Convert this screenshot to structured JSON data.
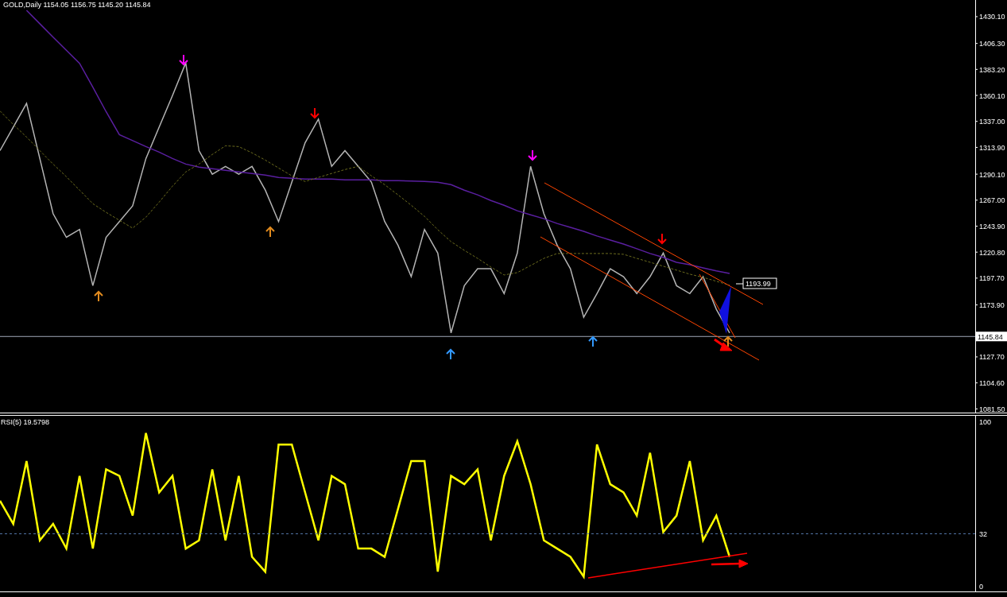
{
  "price_chart": {
    "title": "GOLD,Daily  1154.05 1156.75 1145.20 1145.84",
    "current_price": "1145.84",
    "price_label": "1193.99",
    "chart_data": {
      "type": "line",
      "ylim": [
        1077.5,
        1444.9
      ],
      "yticks": [
        {
          "value": 1430.1,
          "label": "1430.10"
        },
        {
          "value": 1406.3,
          "label": "1406.30"
        },
        {
          "value": 1383.2,
          "label": "1383.20"
        },
        {
          "value": 1360.1,
          "label": "1360.10"
        },
        {
          "value": 1337,
          "label": "1337.00"
        },
        {
          "value": 1313.9,
          "label": "1313.90"
        },
        {
          "value": 1290.1,
          "label": "1290.10"
        },
        {
          "value": 1267,
          "label": "1267.00"
        },
        {
          "value": 1243.9,
          "label": "1243.90"
        },
        {
          "value": 1220.8,
          "label": "1220.80"
        },
        {
          "value": 1197.7,
          "label": "1197.70"
        },
        {
          "value": 1173.9,
          "label": "1173.90"
        },
        {
          "value": 1127.7,
          "label": "1127.70"
        },
        {
          "value": 1104.6,
          "label": "1104.60"
        },
        {
          "value": 1081.5,
          "label": "1081.50"
        }
      ],
      "series": [
        {
          "color": "#b4b4b4",
          "values": [
            1311,
            1332,
            1353,
            1304,
            1255,
            1234,
            1241,
            1191,
            1234,
            1248,
            1262,
            1304,
            1332,
            1360,
            1389,
            1311,
            1290,
            1297,
            1290,
            1297,
            1276,
            1248,
            1283,
            1318,
            1339,
            1297,
            1311,
            1297,
            1283,
            1248,
            1227,
            1199,
            1241,
            1220,
            1149,
            1191,
            1206,
            1206,
            1184,
            1220,
            1297,
            1255,
            1227,
            1206,
            1163,
            1184,
            1206,
            1199,
            1184,
            1199,
            1220,
            1191,
            1184,
            1199,
            1170,
            1149
          ]
        },
        {
          "color": "#5a1fa0",
          "values": [
            null,
            null,
            1435.7,
            1423.8,
            1411.8,
            1400.2,
            1388.6,
            1367.4,
            1345.6,
            1325.2,
            1319.9,
            1314.6,
            1309.7,
            1304,
            1299.1,
            1296.3,
            1294.9,
            1293.5,
            1292.1,
            1290.7,
            1289.3,
            1287.2,
            1286.4,
            1285.7,
            1285.7,
            1285.7,
            1285,
            1285,
            1285,
            1284.3,
            1284.3,
            1284,
            1283.6,
            1282.9,
            1280.8,
            1275.9,
            1271.7,
            1266.7,
            1262.5,
            1257.6,
            1254,
            1250.5,
            1246.3,
            1242.8,
            1239.3,
            1235.1,
            1231.5,
            1228,
            1223.8,
            1219.6,
            1216.1,
            1211.8,
            1209.7,
            1206.9,
            1204.1,
            1201.9
          ]
        },
        {
          "color": "#6b6b1e",
          "line_style": "dashed",
          "values": [
            1346.3,
            1334.3,
            1323.1,
            1311,
            1299.1,
            1287.9,
            1275.9,
            1263.9,
            1256.2,
            1249.1,
            1242.1,
            1251.9,
            1265.3,
            1279.4,
            1292.1,
            1299.1,
            1307.6,
            1315.3,
            1314.6,
            1309,
            1302.6,
            1295.6,
            1288.6,
            1283.6,
            1287.2,
            1290.7,
            1294.2,
            1297,
            1288.6,
            1280.8,
            1271.7,
            1262.5,
            1252.6,
            1240.7,
            1230.1,
            1222.4,
            1215.3,
            1207.6,
            1200.5,
            1202.6,
            1208.9,
            1215.3,
            1219.6,
            1219.6,
            1219.6,
            1219.6,
            1219.6,
            1218.9,
            1215.3,
            1211.8,
            1208.3,
            1204.8,
            1201.2,
            1198.4,
            1194.9,
            1191.4
          ]
        }
      ]
    }
  },
  "rsi_chart": {
    "title": "RSI(5) 19.5798",
    "chart_data": {
      "type": "line",
      "ylim": [
        -3.4,
        103.9
      ],
      "yticks": [
        0,
        32,
        100
      ],
      "series": [
        {
          "color": "#ffff00",
          "values": [
            52,
            38,
            76,
            28,
            38,
            23,
            67,
            23,
            71,
            67,
            43,
            93,
            57,
            67,
            23,
            28,
            71,
            28,
            67,
            18,
            9,
            86,
            86,
            57,
            28,
            67,
            62,
            23,
            23,
            18,
            47,
            76,
            76,
            9,
            67,
            62,
            71,
            28,
            67,
            88,
            62,
            28,
            23,
            18,
            6,
            86,
            62,
            57,
            43,
            81,
            33,
            43,
            76,
            28,
            43,
            18
          ]
        }
      ]
    }
  }
}
